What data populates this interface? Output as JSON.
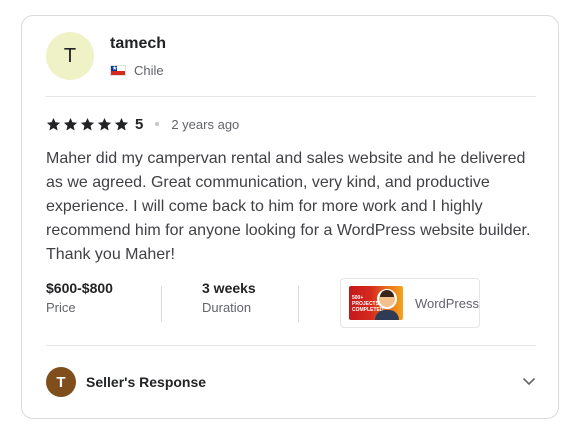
{
  "reviewer": {
    "avatar_letter": "T",
    "name": "tamech",
    "country": "Chile",
    "flag_icon": "chile-flag-icon"
  },
  "rating": {
    "stars": 5,
    "value": "5",
    "time_ago": "2 years ago"
  },
  "review": {
    "text": "Maher did my campervan rental and sales website and he delivered as we agreed. Great communication, very kind, and productive experience. I will come back to him for more work and I highly recommend him for anyone looking for a WordPress website builder. Thank you Maher!"
  },
  "stats": {
    "price": {
      "value": "$600-$800",
      "label": "Price"
    },
    "duration": {
      "value": "3 weeks",
      "label": "Duration"
    },
    "gig": {
      "title": "WordPress",
      "thumb_text": "500+ PROJECTS COMPLETED"
    }
  },
  "seller_response": {
    "avatar_letter": "T",
    "label": "Seller's Response",
    "chevron_icon": "chevron-down-icon"
  },
  "colors": {
    "star": "#222325",
    "reviewer_avatar_bg": "#eff2c7",
    "seller_avatar_bg": "#7f4e1c",
    "text_primary": "#222325",
    "text_secondary": "#62646a",
    "border": "#dadbdd"
  }
}
